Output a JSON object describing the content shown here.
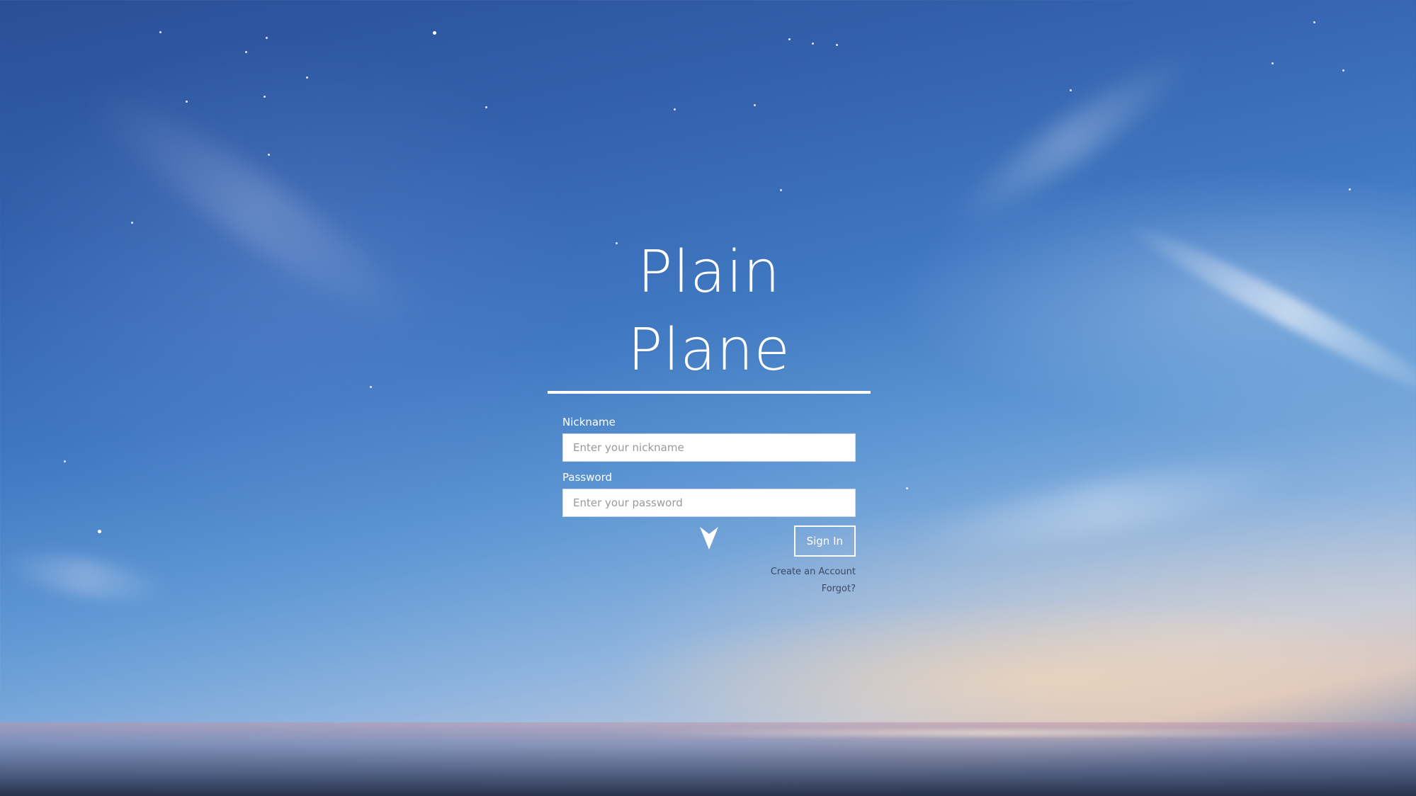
{
  "app": {
    "title": "Plain Plane"
  },
  "form": {
    "nickname_label": "Nickname",
    "nickname_placeholder": "Enter your nickname",
    "nickname_value": "",
    "password_label": "Password",
    "password_placeholder": "Enter your password",
    "password_value": "",
    "signin_label": "Sign In"
  },
  "links": {
    "create_account": "Create an Account",
    "forgot": "Forgot?"
  },
  "icons": {
    "scroll_down": "arrow-down-icon"
  },
  "colors": {
    "text": "#ffffff",
    "link": "#3a4a66",
    "sky_top": "#2a4f98",
    "sky_horizon": "#f5dcc8"
  }
}
